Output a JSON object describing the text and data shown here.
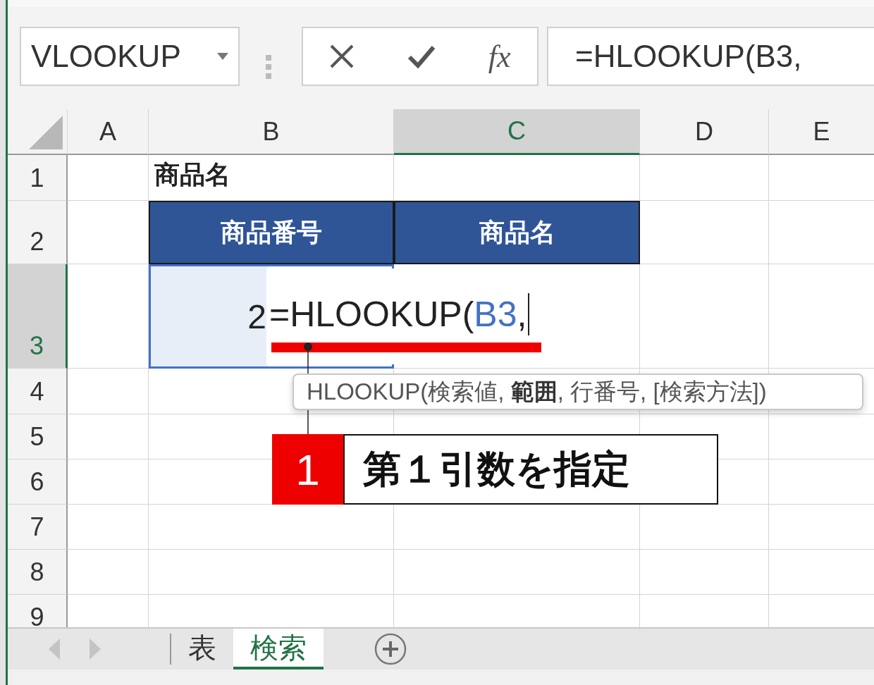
{
  "name_box": {
    "value": "VLOOKUP"
  },
  "formula_bar": {
    "function_label": "fx",
    "value": "=HLOOKUP(B3,"
  },
  "columns": [
    {
      "label": "A",
      "selected": false
    },
    {
      "label": "B",
      "selected": false
    },
    {
      "label": "C",
      "selected": true
    },
    {
      "label": "D",
      "selected": false
    },
    {
      "label": "E",
      "selected": false
    }
  ],
  "rows": [
    {
      "label": "1",
      "selected": false,
      "cells": {
        "B": {
          "text": "商品名",
          "kind": "bold",
          "selected": false
        }
      }
    },
    {
      "label": "2",
      "selected": false,
      "cells": {
        "B": {
          "text": "商品番号",
          "kind": "header",
          "selected": false
        },
        "C": {
          "text": "商品名",
          "kind": "header",
          "selected": false
        }
      }
    },
    {
      "label": "3",
      "selected": true,
      "cells": {
        "B": {
          "text": "2",
          "kind": "number",
          "selected": true
        }
      }
    },
    {
      "label": "4",
      "selected": false
    },
    {
      "label": "5",
      "selected": false
    },
    {
      "label": "6",
      "selected": false
    },
    {
      "label": "7",
      "selected": false
    },
    {
      "label": "8",
      "selected": false
    },
    {
      "label": "9",
      "selected": false
    }
  ],
  "cell_editor": {
    "parts": [
      {
        "text": "=HLOOKUP(",
        "kind": "plain"
      },
      {
        "text": "B3",
        "kind": "reference"
      },
      {
        "text": ",",
        "kind": "plain"
      }
    ]
  },
  "tooltip": {
    "text": "HLOOKUP(検索値, **範囲**, 行番号, [検索方法])"
  },
  "callout": {
    "number": "1",
    "label": "第１引数を指定"
  },
  "sheet_tabs": [
    {
      "label": "表",
      "selected": false
    },
    {
      "label": "検索",
      "selected": true
    }
  ]
}
